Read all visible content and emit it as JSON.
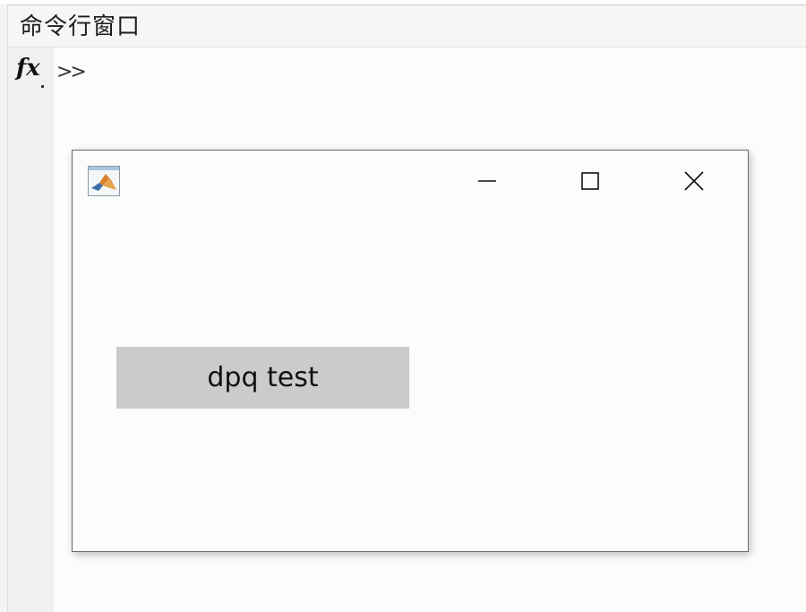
{
  "command_window": {
    "title": "命令行窗口",
    "fx_label": "fx",
    "prompt": ">>"
  },
  "figure": {
    "icon": "matlab-logo-icon",
    "controls": {
      "minimize_icon": "minimize-icon",
      "maximize_icon": "maximize-icon",
      "close_icon": "close-icon"
    },
    "button_label": "dpq test"
  },
  "colors": {
    "panel_bg": "#fcfcfb",
    "header_bg": "#f6f6f5",
    "gutter_bg": "#f0f0ef",
    "button_bg": "#cbcbcb",
    "window_border": "#6b6b6b"
  }
}
